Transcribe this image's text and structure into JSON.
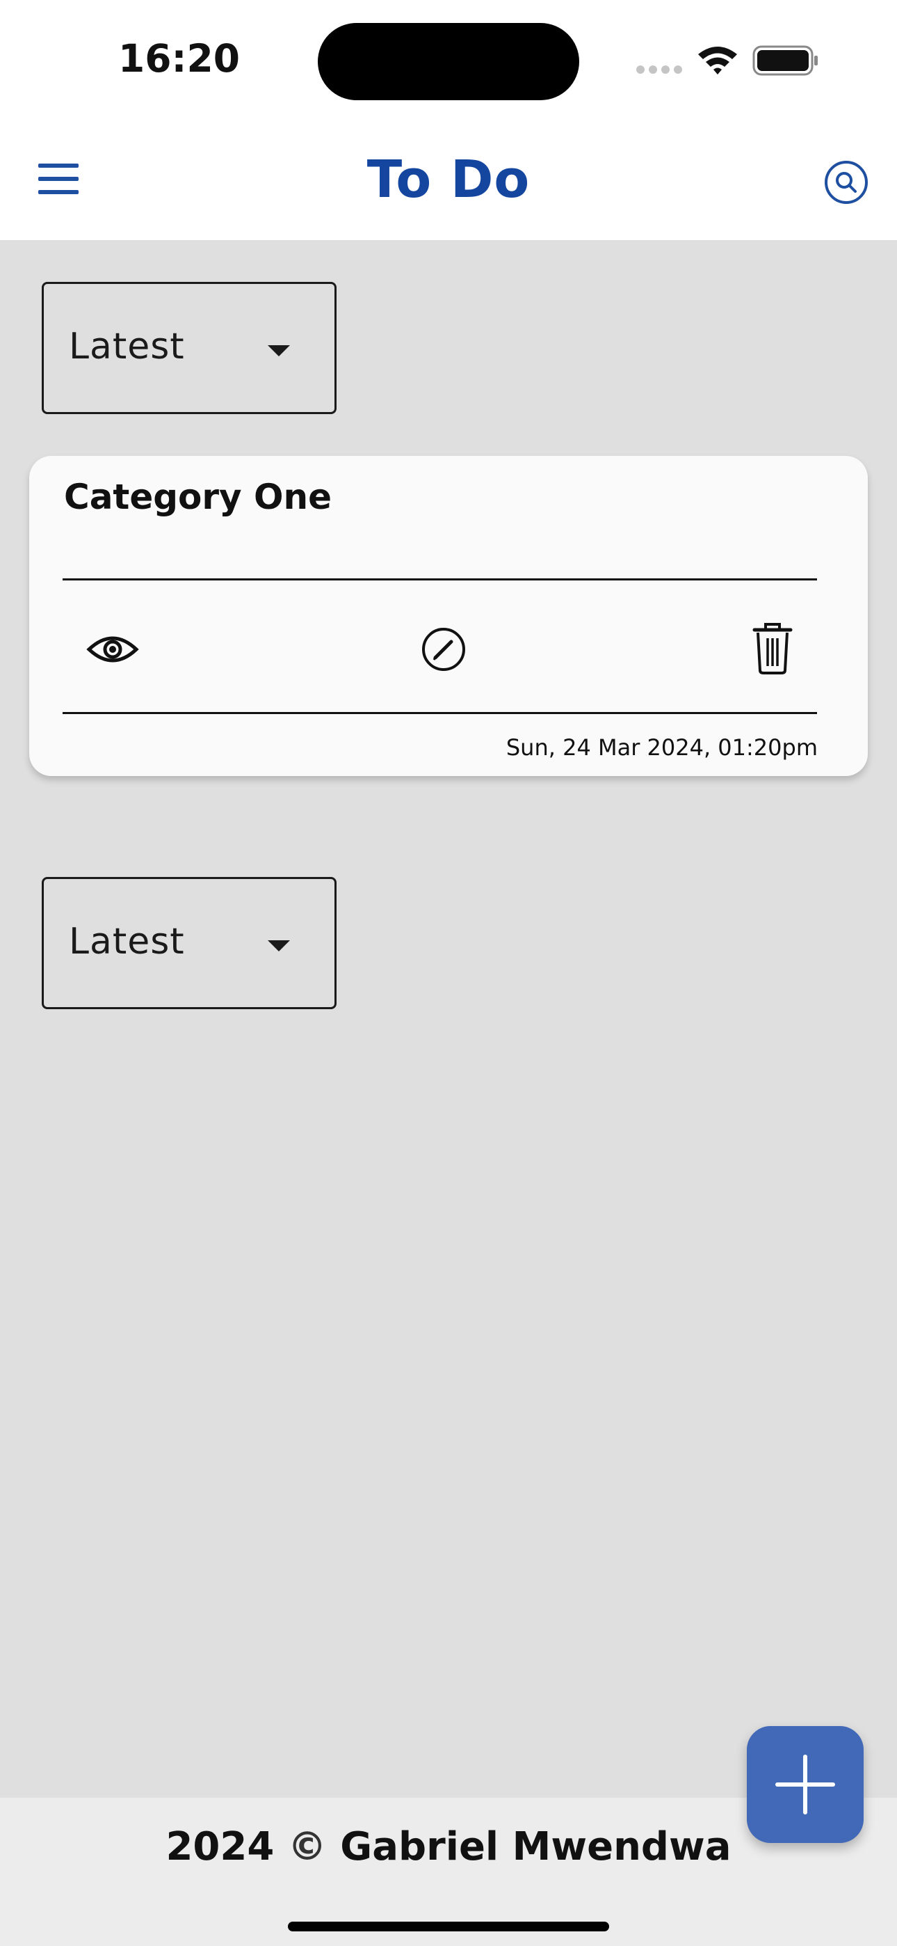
{
  "status_bar": {
    "time": "16:20"
  },
  "app_bar": {
    "title": "To Do",
    "accent_color": "#1446a0"
  },
  "sort_dropdowns": [
    {
      "selected": "Latest"
    },
    {
      "selected": "Latest"
    }
  ],
  "category_card": {
    "title": "Category One",
    "date": "Sun, 24 Mar 2024, 01:20pm",
    "actions": [
      "view-icon",
      "edit-icon",
      "delete-icon"
    ]
  },
  "fab": {
    "icon": "plus-icon",
    "color": "#4169b8"
  },
  "footer": {
    "year": "2024",
    "copyright_symbol": "©",
    "author": "Gabriel Mwendwa"
  }
}
